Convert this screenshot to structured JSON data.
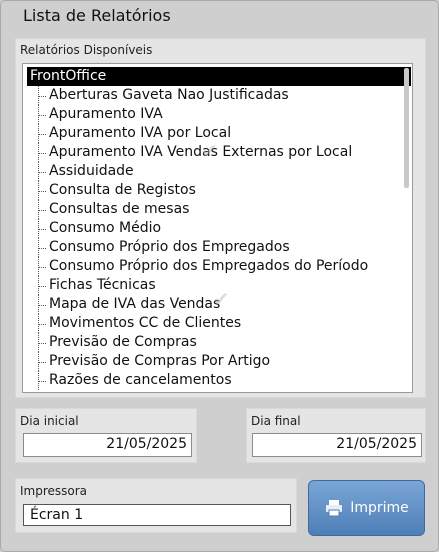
{
  "window": {
    "title": "Lista de Relatórios"
  },
  "reports": {
    "label": "Relatórios Disponíveis",
    "root": "FrontOffice",
    "items": [
      "Aberturas Gaveta Nao Justificadas",
      "Apuramento IVA",
      "Apuramento IVA por Local",
      "Apuramento IVA Vendas Externas por Local",
      "Assiduidade",
      "Consulta de Registos",
      "Consultas de mesas",
      "Consumo Médio",
      "Consumo Próprio dos Empregados",
      "Consumo Próprio dos Empregados do Período",
      "Fichas Técnicas",
      "Mapa de IVA das Vendas",
      "Movimentos CC de Clientes",
      "Previsão de Compras",
      "Previsão de Compras Por Artigo",
      "Razões de cancelamentos"
    ]
  },
  "dates": {
    "start_label": "Dia inicial",
    "start_value": "21/05/2025",
    "end_label": "Dia final",
    "end_value": "21/05/2025"
  },
  "printer": {
    "label": "Impressora",
    "selected": "Écran 1"
  },
  "actions": {
    "print_label": "Imprime",
    "print_icon": "printer-icon"
  }
}
